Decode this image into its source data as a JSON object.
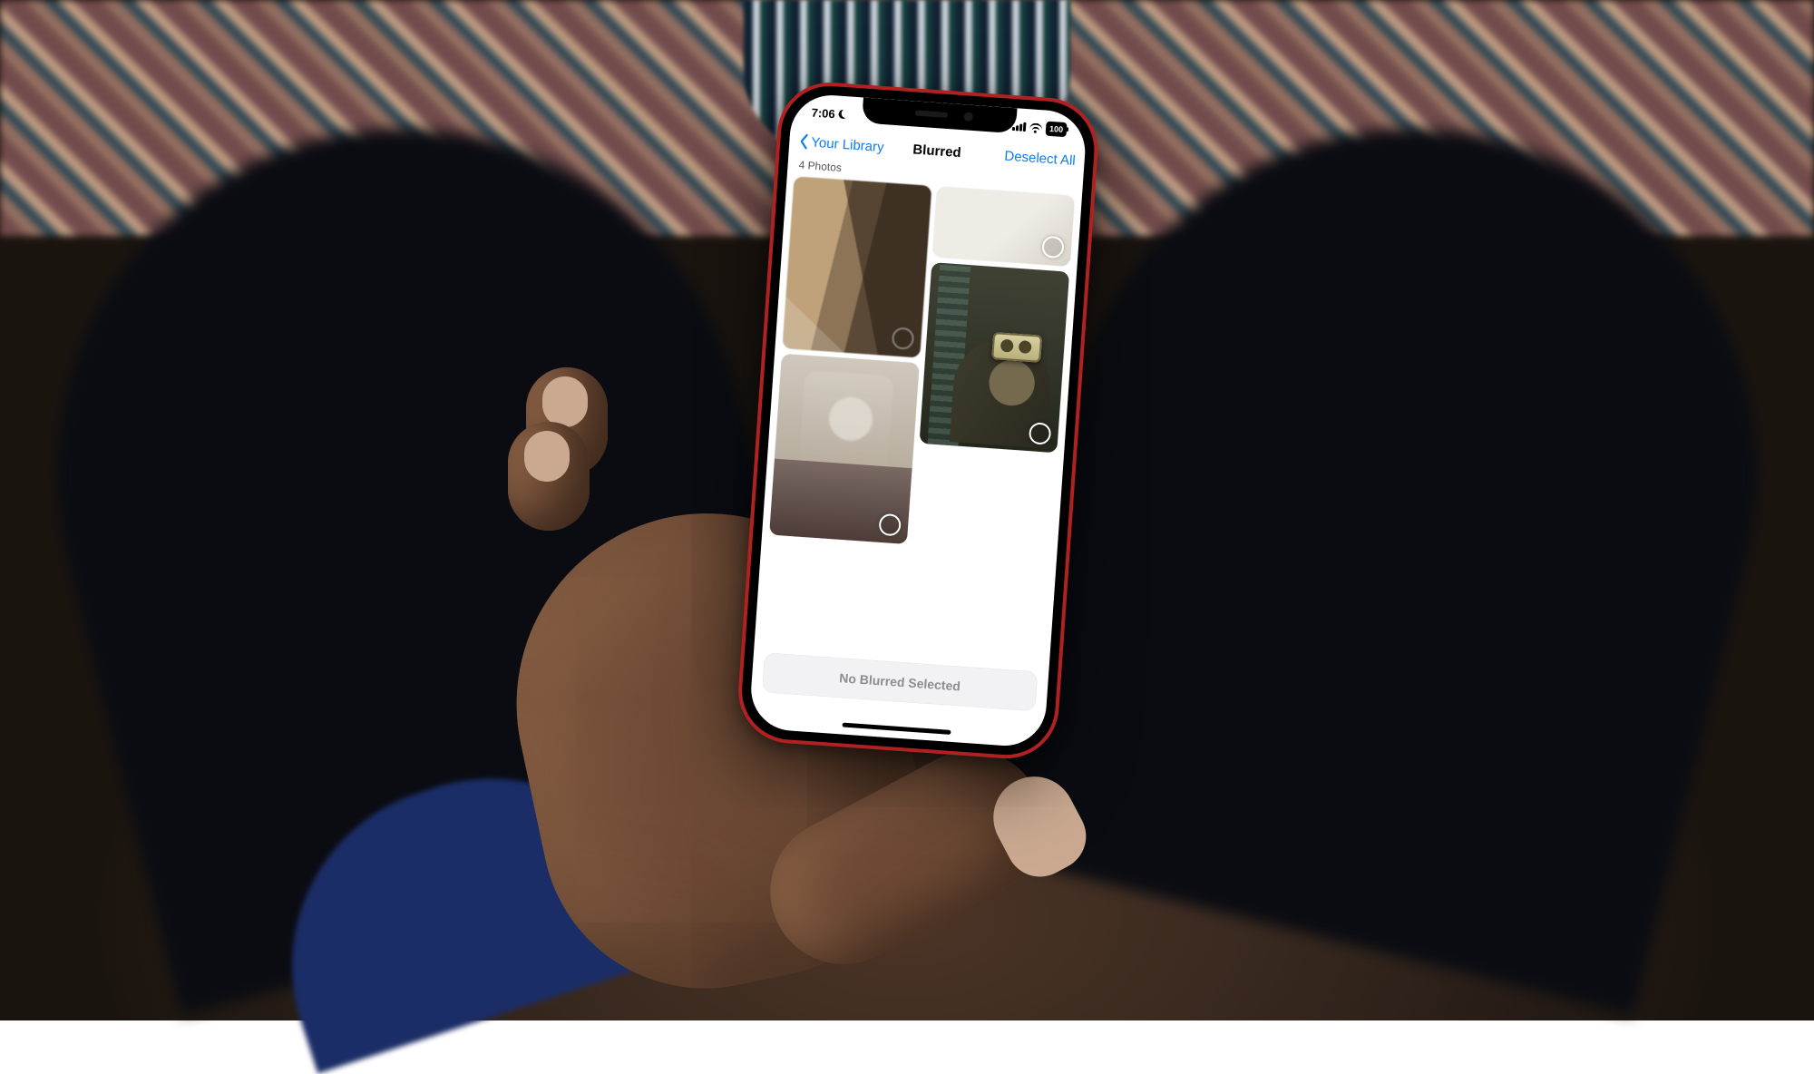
{
  "status": {
    "time": "7:06",
    "battery": "100"
  },
  "nav": {
    "back_label": "Your Library",
    "title": "Blurred",
    "action_label": "Deselect All"
  },
  "count_label": "4 Photos",
  "photos": [
    {
      "id": "photo-1",
      "selected": false
    },
    {
      "id": "photo-2",
      "selected": false
    },
    {
      "id": "photo-3",
      "selected": false
    },
    {
      "id": "photo-4",
      "selected": false
    }
  ],
  "bottom_button": {
    "label": "No Blurred Selected"
  },
  "colors": {
    "ios_blue": "#0a7aff",
    "device_red": "#b02222"
  }
}
